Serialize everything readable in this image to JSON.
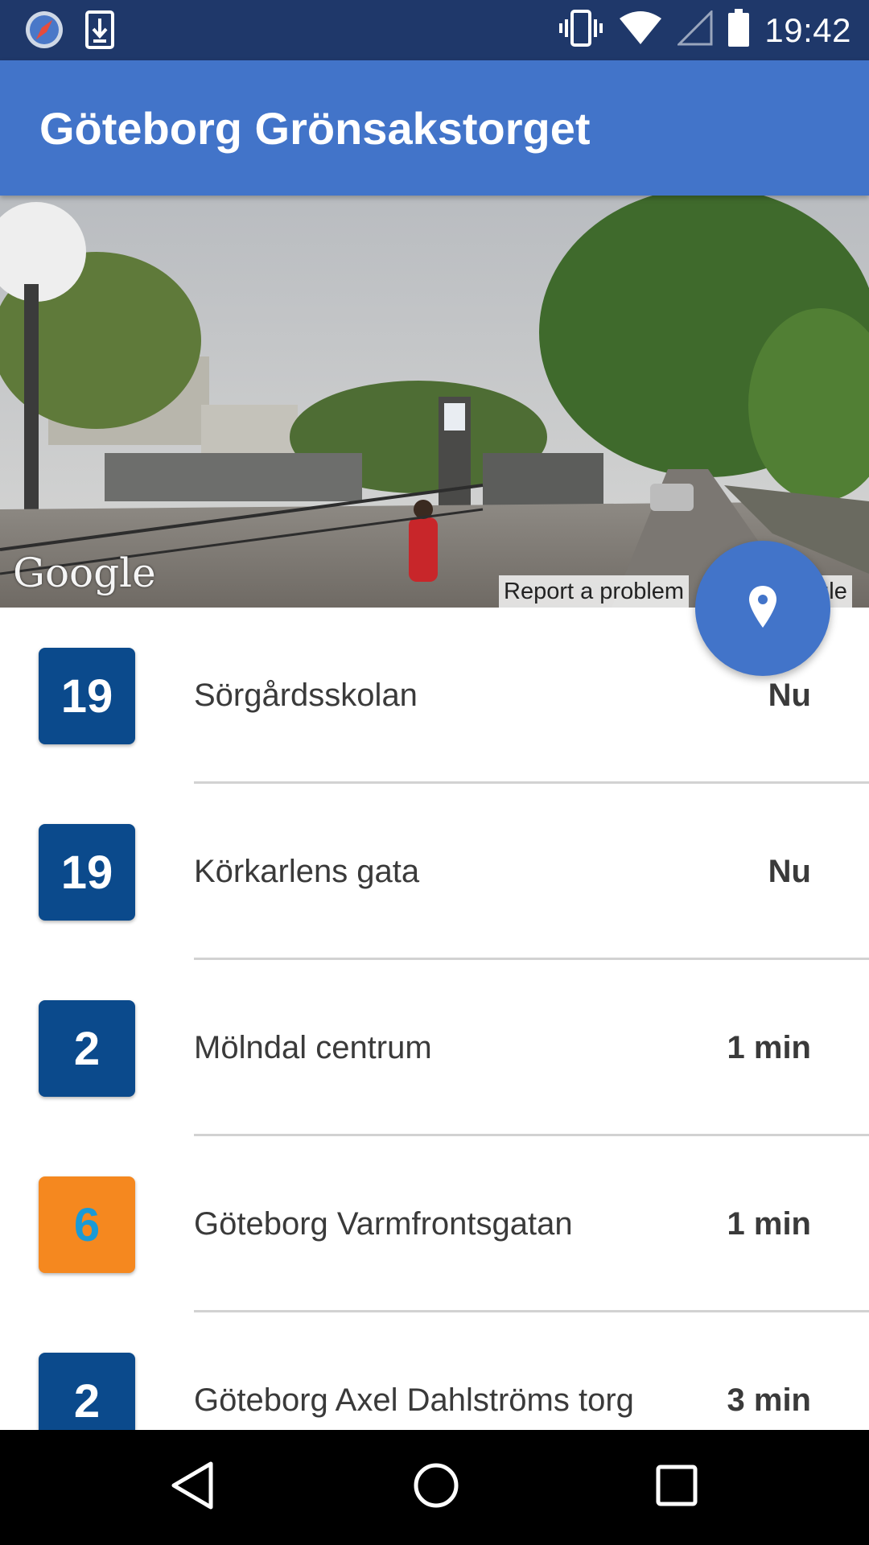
{
  "status_bar": {
    "time": "19:42",
    "left_icons": [
      "compass-icon",
      "download-icon"
    ],
    "right_icons": [
      "vibrate-icon",
      "wifi-icon",
      "cell-signal-icon",
      "battery-icon"
    ]
  },
  "app_bar": {
    "title": "Göteborg Grönsakstorget"
  },
  "street_view": {
    "watermark": "Google",
    "report_link": "Report a problem",
    "copyright": "ogle"
  },
  "fab": {
    "icon": "location-pin-icon"
  },
  "departures": [
    {
      "line": "19",
      "destination": "Sörgårdsskolan",
      "eta": "Nu",
      "bg": "#0b4a8c",
      "fg": "#ffffff"
    },
    {
      "line": "19",
      "destination": "Körkarlens gata",
      "eta": "Nu",
      "bg": "#0b4a8c",
      "fg": "#ffffff"
    },
    {
      "line": "2",
      "destination": "Mölndal centrum",
      "eta": "1 min",
      "bg": "#0b4a8c",
      "fg": "#ffffff"
    },
    {
      "line": "6",
      "destination": "Göteborg Varmfrontsgatan",
      "eta": "1 min",
      "bg": "#f5881f",
      "fg": "#1a9ad6"
    },
    {
      "line": "2",
      "destination": "Göteborg Axel Dahlströms torg",
      "eta": "3 min",
      "bg": "#0b4a8c",
      "fg": "#ffffff"
    }
  ],
  "nav_bar": {
    "icons": [
      "back-icon",
      "home-icon",
      "recents-icon"
    ]
  },
  "colors": {
    "status_bar": "#1f386a",
    "app_bar": "#4274c9",
    "fab": "#4274c9",
    "divider": "#d2d2d2"
  }
}
